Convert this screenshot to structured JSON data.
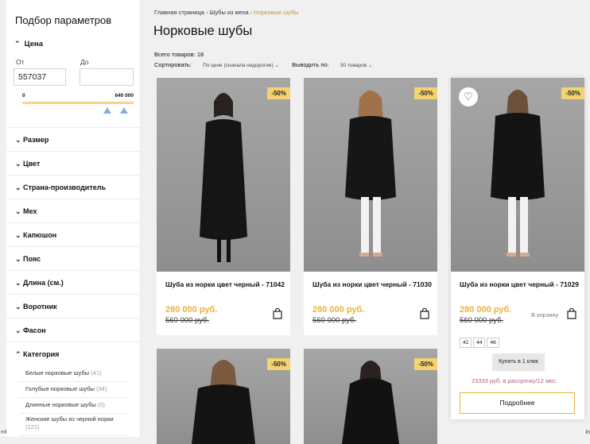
{
  "filters": {
    "title": "Подбор параметров",
    "price": {
      "label": "Цена",
      "from_label": "От",
      "to_label": "До",
      "from_value": "557037",
      "to_value": "",
      "range_min": "0",
      "range_max": "640 000"
    },
    "sections": [
      "Размер",
      "Цвет",
      "Страна-производитель",
      "Мех",
      "Капюшон",
      "Пояс",
      "Длина (см.)",
      "Воротник",
      "Фасон",
      "Категория"
    ],
    "category_items": [
      {
        "label": "Белые норковые шубы",
        "count": "(41)"
      },
      {
        "label": "Голубые норковые шубы",
        "count": "(34)"
      },
      {
        "label": "Длинные норковые шубы",
        "count": "(0)"
      },
      {
        "label": "Женские шубы из черной норки",
        "count": "(121)"
      }
    ]
  },
  "breadcrumbs": [
    "Главная страница",
    "Шубы из меха",
    "Норковые шубы"
  ],
  "page_title": "Норковые шубы",
  "total": "Всего товаров: 18",
  "sort": {
    "label": "Сортировать:",
    "value": "По цене (сначала недорогие)"
  },
  "perpage": {
    "label": "Выводить по:",
    "value": "30 товаров"
  },
  "products": [
    {
      "badge": "-50%",
      "name": "Шуба из норки цвет черный - 71042",
      "price": "280 000 руб.",
      "old_price": "560 000 руб."
    },
    {
      "badge": "-50%",
      "name": "Шуба из норки цвет черный - 71030",
      "price": "280 000 руб.",
      "old_price": "560 000 руб."
    },
    {
      "badge": "-50%",
      "name": "Шуба из норки цвет черный - 71029",
      "price": "280 000 руб.",
      "old_price": "560 000 руб.",
      "to_cart": "В корзину",
      "sizes": [
        "42",
        "44",
        "46"
      ],
      "one_click": "Купить в 1 клик",
      "installment": "23333 руб. в рассрочку/12 мес.",
      "more": "Подробнее"
    },
    {
      "badge": "-50%"
    },
    {
      "badge": "-50%"
    }
  ],
  "edge_text_left": "ml",
  "edge_text_right": "in",
  "colors": {
    "accent": "#f4d370",
    "price": "#e6b43c",
    "breadcrumb_active": "#c69a2c",
    "installment": "#b05c8a"
  }
}
